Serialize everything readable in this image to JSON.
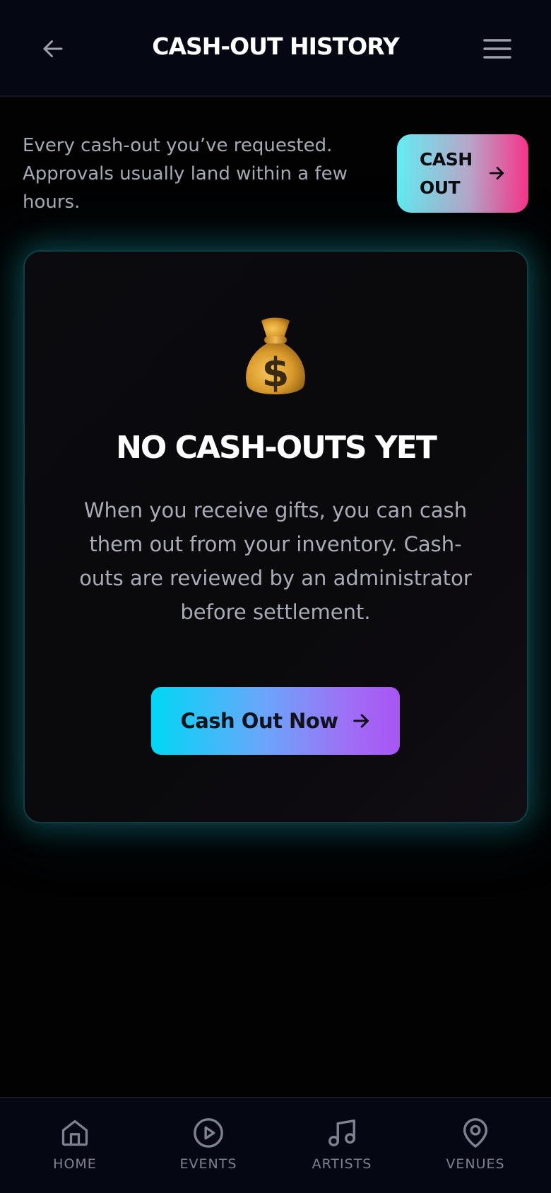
{
  "header": {
    "title": "CASH-OUT HISTORY",
    "back_icon": "arrow-left-icon",
    "menu_icon": "hamburger-menu-icon"
  },
  "intro": {
    "text": "Every cash-out you’ve requested. Approvals usually land within a few hours.",
    "cashout_button": "CASH OUT",
    "cashout_icon": "arrow-right-icon"
  },
  "empty_state": {
    "icon": "money-bag-icon",
    "title": "NO CASH-OUTS YET",
    "description": "When you receive gifts, you can cash them out from your inventory. Cash-outs are reviewed by an administrator before settlement.",
    "cta_label": "Cash Out Now",
    "cta_icon": "arrow-right-icon"
  },
  "bottom_nav": {
    "items": [
      {
        "label": "HOME",
        "icon": "home-icon"
      },
      {
        "label": "EVENTS",
        "icon": "play-circle-icon"
      },
      {
        "label": "ARTISTS",
        "icon": "music-note-icon"
      },
      {
        "label": "VENUES",
        "icon": "map-pin-icon"
      }
    ]
  },
  "colors": {
    "background": "#020203",
    "header_bg": "#050812",
    "accent_cyan": "#00d8f5",
    "accent_purple": "#a855f5",
    "accent_pink": "#f7338a",
    "card_glow": "#12828c",
    "muted_text": "#a9acb7"
  }
}
